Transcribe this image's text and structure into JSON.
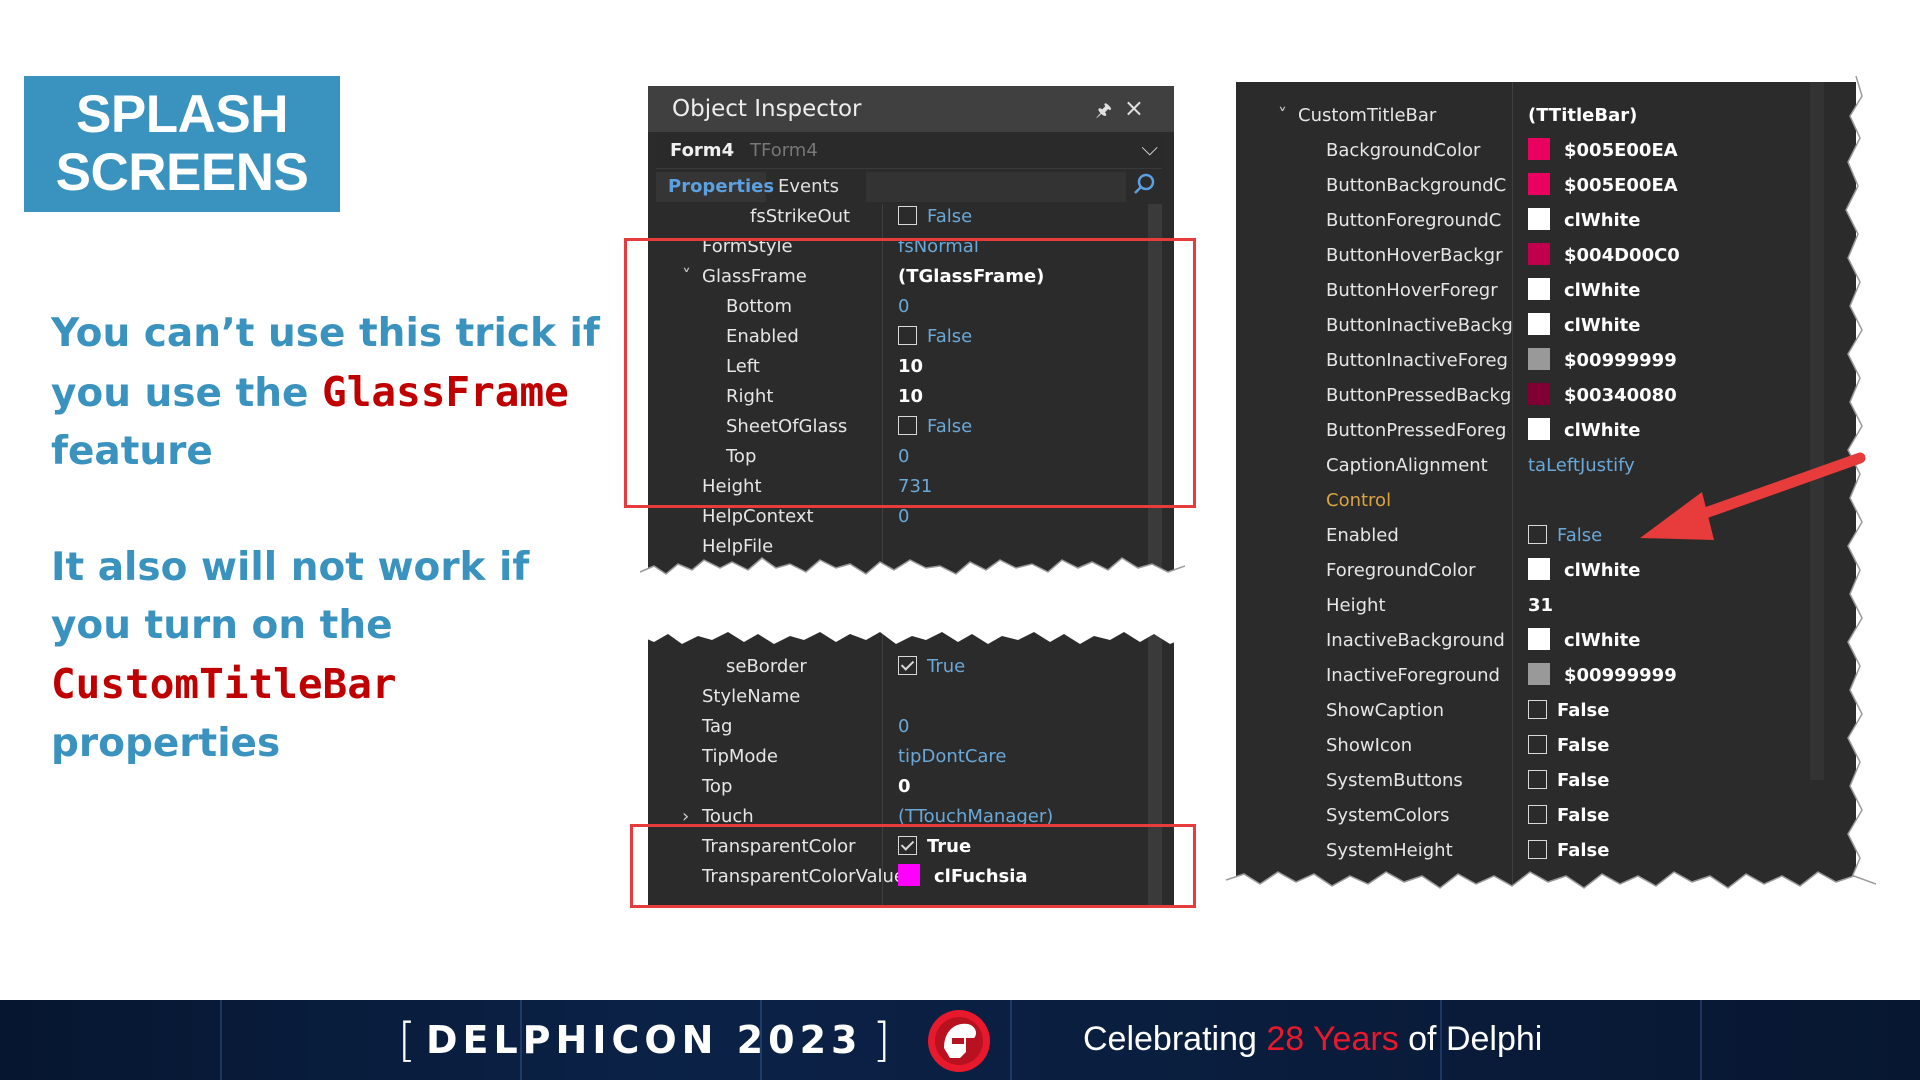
{
  "slide": {
    "title_line1": "SPLASH",
    "title_line2": "SCREENS",
    "para1": {
      "before": "You can’t use this trick if you use the ",
      "code": "GlassFrame",
      "after": " feature"
    },
    "para2": {
      "before": "It also will not work if you turn on the ",
      "code": "CustomTitleBar",
      "after": " properties"
    }
  },
  "object_inspector": {
    "title": "Object Inspector",
    "form_name": "Form4",
    "form_class": "TForm4",
    "tab_properties": "Properties",
    "tab_events": "Events",
    "top_rows": [
      {
        "name": "fsStrikeOut",
        "value": "False",
        "indent": 3,
        "kind": "checkbox"
      },
      {
        "name": "FormStyle",
        "value": "fsNormal",
        "indent": 1,
        "kind": "blue"
      },
      {
        "name": "GlassFrame",
        "value": "(TGlassFrame)",
        "indent": 1,
        "kind": "bold",
        "expander": "˅"
      },
      {
        "name": "Bottom",
        "value": "0",
        "indent": 2,
        "kind": "blue"
      },
      {
        "name": "Enabled",
        "value": "False",
        "indent": 2,
        "kind": "checkbox"
      },
      {
        "name": "Left",
        "value": "10",
        "indent": 2,
        "kind": "bold"
      },
      {
        "name": "Right",
        "value": "10",
        "indent": 2,
        "kind": "bold"
      },
      {
        "name": "SheetOfGlass",
        "value": "False",
        "indent": 2,
        "kind": "checkbox"
      },
      {
        "name": "Top",
        "value": "0",
        "indent": 2,
        "kind": "blue"
      },
      {
        "name": "Height",
        "value": "731",
        "indent": 1,
        "kind": "blue"
      },
      {
        "name": "HelpContext",
        "value": "0",
        "indent": 1,
        "kind": "blue"
      },
      {
        "name": "HelpFile",
        "value": "",
        "indent": 1,
        "kind": "blue"
      }
    ],
    "bottom_rows": [
      {
        "name": "seBorder",
        "value": "True",
        "indent": 2,
        "kind": "checkbox-checked"
      },
      {
        "name": "StyleName",
        "value": "",
        "indent": 1,
        "kind": "blue"
      },
      {
        "name": "Tag",
        "value": "0",
        "indent": 1,
        "kind": "blue"
      },
      {
        "name": "TipMode",
        "value": "tipDontCare",
        "indent": 1,
        "kind": "blue"
      },
      {
        "name": "Top",
        "value": "0",
        "indent": 1,
        "kind": "bold"
      },
      {
        "name": "Touch",
        "value": "(TTouchManager)",
        "indent": 1,
        "kind": "blue",
        "expander": "›"
      },
      {
        "name": "TransparentColor",
        "value": "True",
        "indent": 1,
        "kind": "checkbox-checked-bold"
      },
      {
        "name": "TransparentColorValue",
        "value": "clFuchsia",
        "indent": 1,
        "kind": "swatch-bold",
        "color": "#ff00ff"
      }
    ]
  },
  "custom_titlebar": {
    "rows": [
      {
        "name": "CustomTitleBar",
        "value": "(TTitleBar)",
        "kind": "bold",
        "indent": 1,
        "expander": "˅"
      },
      {
        "name": "BackgroundColor",
        "value": "$005E00EA",
        "kind": "swatch-bold",
        "color": "#ea005e",
        "indent": 2
      },
      {
        "name": "ButtonBackgroundC",
        "value": "$005E00EA",
        "kind": "swatch-bold",
        "color": "#ea005e",
        "indent": 2
      },
      {
        "name": "ButtonForegroundC",
        "value": "clWhite",
        "kind": "swatch-bold",
        "color": "#ffffff",
        "indent": 2
      },
      {
        "name": "ButtonHoverBackgr",
        "value": "$004D00C0",
        "kind": "swatch-bold",
        "color": "#c0004d",
        "indent": 2
      },
      {
        "name": "ButtonHoverForegr",
        "value": "clWhite",
        "kind": "swatch-bold",
        "color": "#ffffff",
        "indent": 2
      },
      {
        "name": "ButtonInactiveBackg",
        "value": "clWhite",
        "kind": "swatch-bold",
        "color": "#ffffff",
        "indent": 2
      },
      {
        "name": "ButtonInactiveForeg",
        "value": "$00999999",
        "kind": "swatch-bold",
        "color": "#999999",
        "indent": 2
      },
      {
        "name": "ButtonPressedBackg",
        "value": "$00340080",
        "kind": "swatch-bold",
        "color": "#800034",
        "indent": 2
      },
      {
        "name": "ButtonPressedForeg",
        "value": "clWhite",
        "kind": "swatch-bold",
        "color": "#ffffff",
        "indent": 2
      },
      {
        "name": "CaptionAlignment",
        "value": "taLeftJustify",
        "kind": "blue",
        "indent": 2
      },
      {
        "name": "Control",
        "value": "",
        "kind": "section",
        "indent": 2
      },
      {
        "name": "Enabled",
        "value": "False",
        "kind": "checkbox",
        "indent": 2
      },
      {
        "name": "ForegroundColor",
        "value": "clWhite",
        "kind": "swatch-bold",
        "color": "#ffffff",
        "indent": 2
      },
      {
        "name": "Height",
        "value": "31",
        "kind": "bold",
        "indent": 2
      },
      {
        "name": "InactiveBackground",
        "value": "clWhite",
        "kind": "swatch-bold",
        "color": "#ffffff",
        "indent": 2
      },
      {
        "name": "InactiveForeground",
        "value": "$00999999",
        "kind": "swatch-bold",
        "color": "#999999",
        "indent": 2
      },
      {
        "name": "ShowCaption",
        "value": "False",
        "kind": "checkbox-bold",
        "indent": 2
      },
      {
        "name": "ShowIcon",
        "value": "False",
        "kind": "checkbox-bold",
        "indent": 2
      },
      {
        "name": "SystemButtons",
        "value": "False",
        "kind": "checkbox-bold",
        "indent": 2
      },
      {
        "name": "SystemColors",
        "value": "False",
        "kind": "checkbox-bold",
        "indent": 2
      },
      {
        "name": "SystemHeight",
        "value": "False",
        "kind": "checkbox-bold",
        "indent": 2
      }
    ]
  },
  "footer": {
    "brand": "DELPHICON 2023",
    "tag_before": "Celebrating ",
    "tag_highlight": "28 Years",
    "tag_after": " of Delphi"
  },
  "colors": {
    "accent": "#3a93bf",
    "code": "#c00000",
    "highlight_box": "#e83b3b",
    "footer_bg": "#0b2247"
  }
}
